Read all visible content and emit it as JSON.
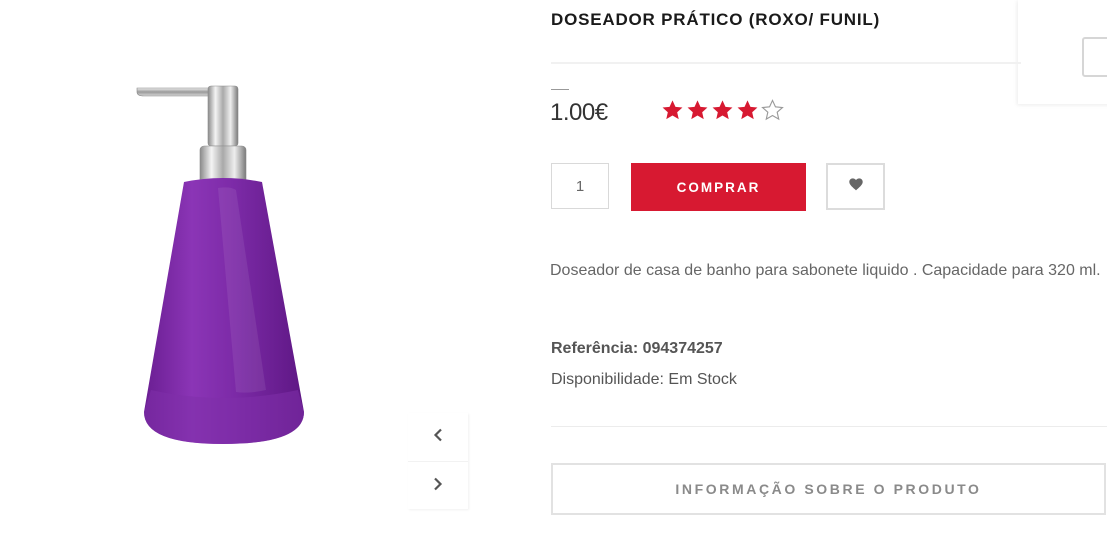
{
  "product": {
    "title": "DOSEADOR PRÁTICO (ROXO/ FUNIL)",
    "price": "1.00€",
    "rating": 4,
    "rating_max": 5,
    "quantity": "1",
    "buy_label": "COMPRAR",
    "description": "Doseador de casa de banho para sabonete liquido . Capacidade para 320 ml.",
    "reference_label": "Referência:",
    "reference_value": "094374257",
    "availability_label": "Disponibilidade:",
    "availability_value": "Em Stock",
    "info_label": "INFORMAÇÃO SOBRE O PRODUTO"
  },
  "icons": {
    "prev": "chevron-left-icon",
    "next": "chevron-right-icon",
    "wishlist": "heart-icon",
    "star_filled": "star-filled-icon",
    "star_empty": "star-outline-icon"
  },
  "colors": {
    "accent": "#d71931",
    "star": "#d71931",
    "bottle": "#7e2aa5",
    "title": "#1a1a1a"
  }
}
